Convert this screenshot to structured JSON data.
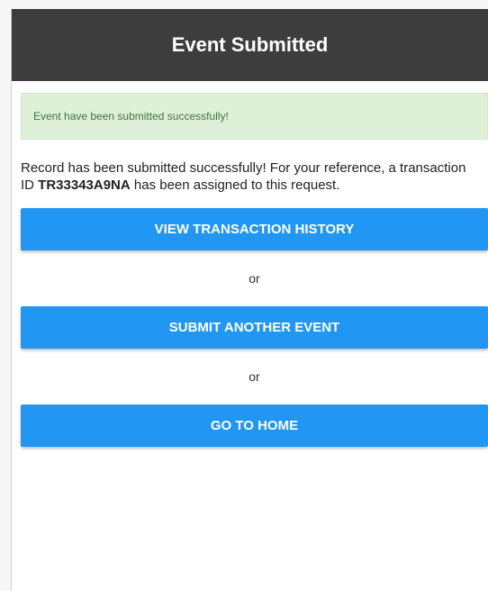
{
  "header": {
    "title": "Event Submitted"
  },
  "alert": {
    "text": "Event have been submitted successfully!"
  },
  "message": {
    "prefix": "Record has been submitted successfully! For your reference, a transaction ID ",
    "transaction_id": "TR33343A9NA",
    "suffix": " has been assigned to this request."
  },
  "buttons": {
    "view_history": "VIEW TRANSACTION HISTORY",
    "submit_another": "SUBMIT ANOTHER EVENT",
    "go_home": "GO TO HOME"
  },
  "separators": {
    "or_1": "or",
    "or_2": "or"
  },
  "colors": {
    "header_bg": "#3d3d3d",
    "alert_bg": "#dff0d8",
    "alert_text": "#3c763d",
    "button_bg": "#2196f3"
  }
}
